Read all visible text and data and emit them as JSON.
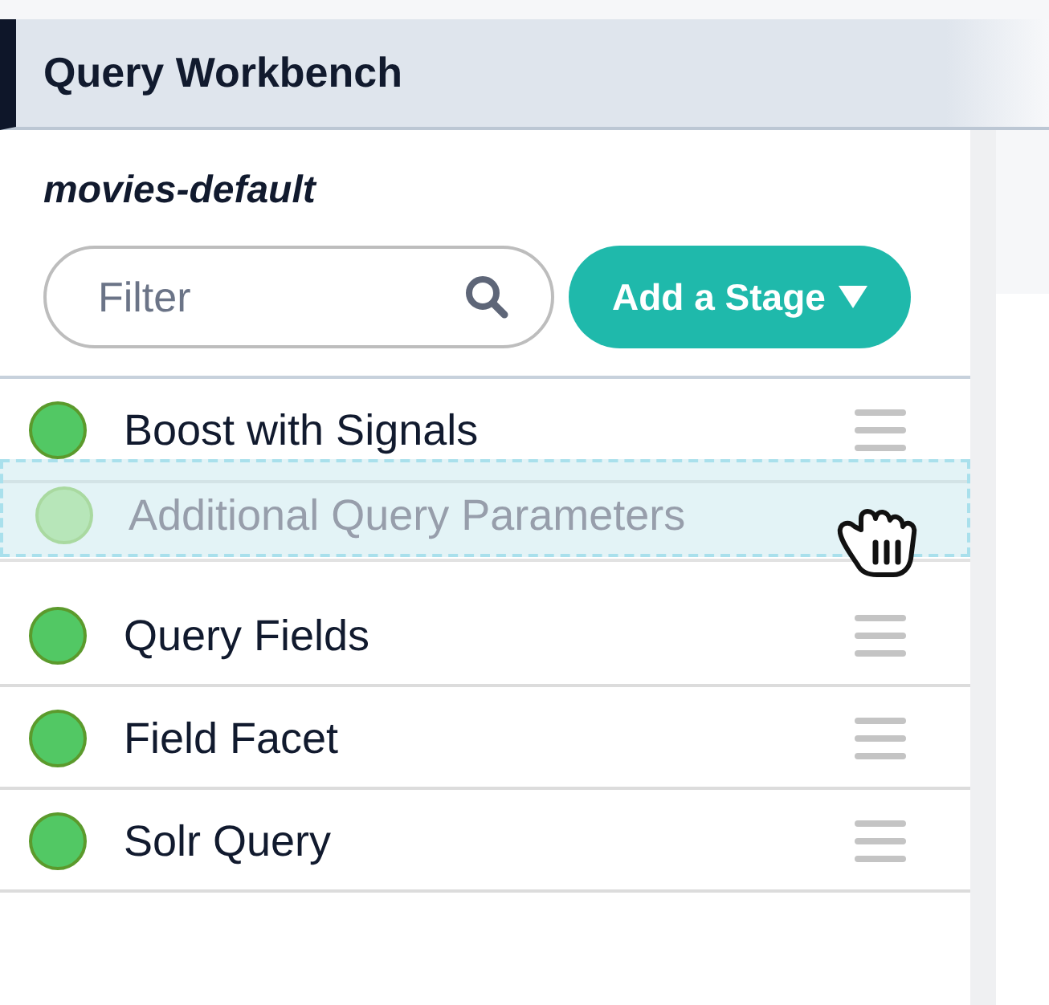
{
  "header": {
    "title": "Query Workbench"
  },
  "pipeline": {
    "name": "movies-default"
  },
  "filter": {
    "placeholder": "Filter"
  },
  "add_button": {
    "label": "Add a Stage"
  },
  "stages": [
    {
      "name": "Boost with Signals",
      "enabled": true,
      "dragging": false
    },
    {
      "name": "Additional Query Parameters",
      "enabled": true,
      "dragging": true
    },
    {
      "name": "Query Fields",
      "enabled": true,
      "dragging": false
    },
    {
      "name": "Field Facet",
      "enabled": true,
      "dragging": false
    },
    {
      "name": "Solr Query",
      "enabled": true,
      "dragging": false
    }
  ]
}
